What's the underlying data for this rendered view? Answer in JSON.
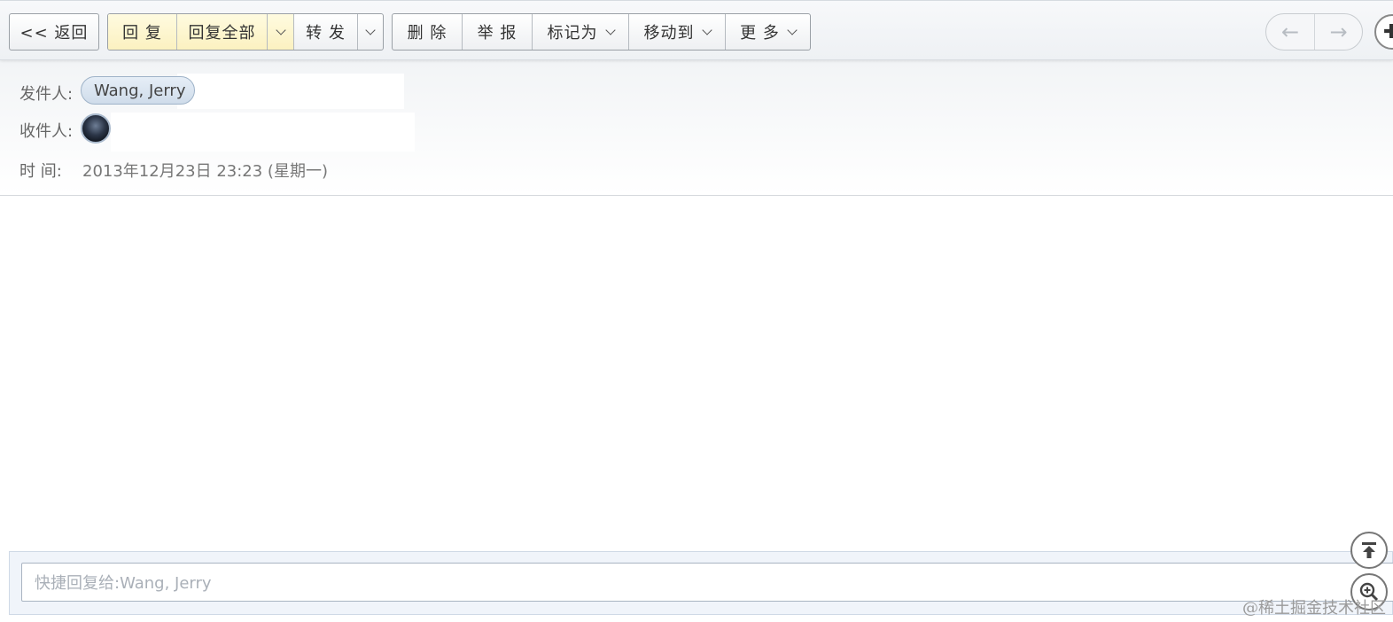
{
  "toolbar": {
    "back_label": "<< 返回",
    "reply_label": "回 复",
    "reply_all_label": "回复全部",
    "forward_label": "转 发",
    "delete_label": "删 除",
    "report_label": "举 报",
    "mark_label": "标记为",
    "move_label": "移动到",
    "more_label": "更 多",
    "prev_arrow": "←",
    "next_arrow": "→"
  },
  "header": {
    "from_label": "发件人:",
    "from_name": "Wang, Jerry",
    "to_label": "收件人:",
    "time_label": "时   间:",
    "time_value": "2013年12月23日 23:23 (星期一)"
  },
  "quick_reply": {
    "placeholder": "快捷回复给:Wang, Jerry"
  },
  "watermark": "@稀土掘金技术社区",
  "colors": {
    "highlight_button": "#fbf1c0",
    "chip_bg": "#cfdcea",
    "quick_reply_bg": "#f0f4fa"
  }
}
